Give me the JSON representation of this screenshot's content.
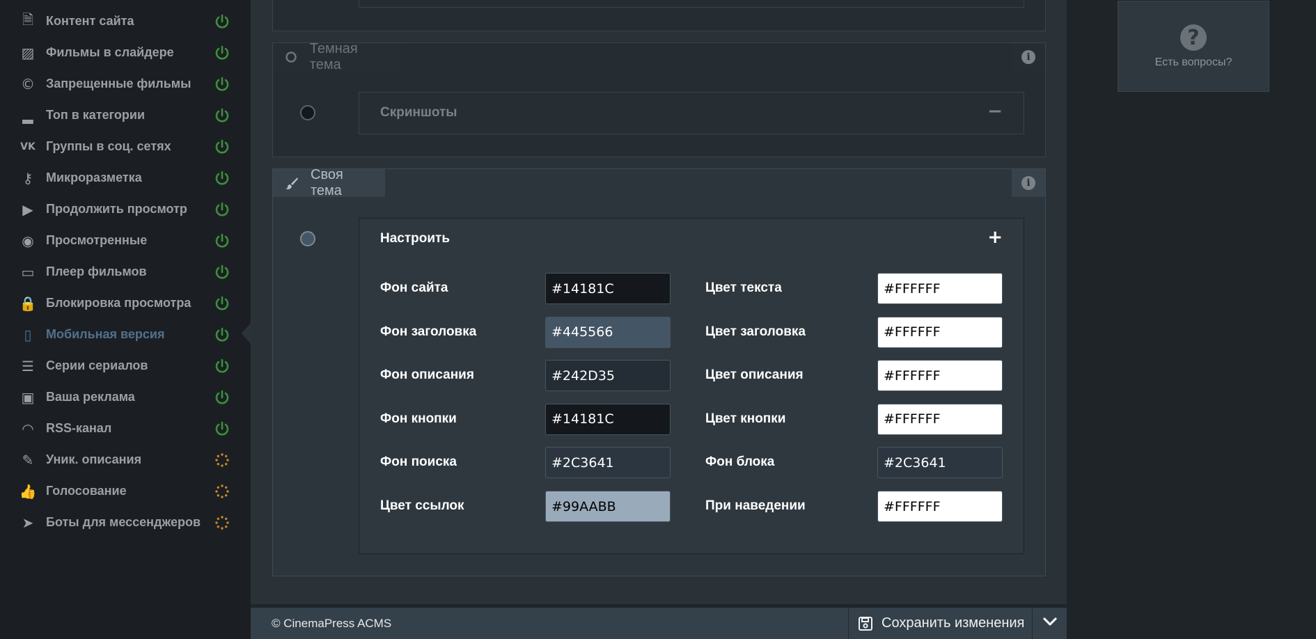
{
  "sidebar": {
    "items": [
      {
        "label": "Контент сайта",
        "icon": "document-icon",
        "status": "power-on"
      },
      {
        "label": "Фильмы в слайдере",
        "icon": "image-icon",
        "status": "power-on"
      },
      {
        "label": "Запрещенные фильмы",
        "icon": "copyright-icon",
        "status": "power-on"
      },
      {
        "label": "Топ в категории",
        "icon": "signal-bars-icon",
        "status": "power-on"
      },
      {
        "label": "Группы в соц. сетях",
        "icon": "vk-icon",
        "status": "power-on"
      },
      {
        "label": "Микроразметка",
        "icon": "key-icon",
        "status": "power-on"
      },
      {
        "label": "Продолжить просмотр",
        "icon": "play-icon",
        "status": "power-on"
      },
      {
        "label": "Просмотренные",
        "icon": "eye-icon",
        "status": "power-on"
      },
      {
        "label": "Плеер фильмов",
        "icon": "monitor-icon",
        "status": "power-on"
      },
      {
        "label": "Блокировка просмотра",
        "icon": "lock-icon",
        "status": "power-on"
      },
      {
        "label": "Мобильная версия",
        "icon": "mobile-icon",
        "status": "power-on",
        "active": true
      },
      {
        "label": "Серии сериалов",
        "icon": "list-icon",
        "status": "power-on"
      },
      {
        "label": "Ваша реклама",
        "icon": "money-icon",
        "status": "power-on"
      },
      {
        "label": "RSS-канал",
        "icon": "rss-icon",
        "status": "power-on"
      },
      {
        "label": "Уник. описания",
        "icon": "pencil-icon",
        "status": "loading"
      },
      {
        "label": "Голосование",
        "icon": "thumbs-up-icon",
        "status": "loading"
      },
      {
        "label": "Боты для мессенджеров",
        "icon": "telegram-icon",
        "status": "loading"
      }
    ]
  },
  "help": {
    "label": "Есть вопросы?",
    "icon": "question-icon"
  },
  "dark_theme": {
    "tab_label": "Темная тема",
    "accordion_title": "Скриншоты",
    "toggle": "−"
  },
  "custom_theme": {
    "tab_label": "Своя тема",
    "accordion_title": "Настроить",
    "toggle": "+",
    "fields": [
      {
        "label": "Фон сайта",
        "value": "#14181C",
        "color": "#14181C",
        "text_color": "#FFFFFF"
      },
      {
        "label": "Фон заголовка",
        "value": "#445566",
        "color": "#445566",
        "text_color": "#FFFFFF"
      },
      {
        "label": "Фон описания",
        "value": "#242D35",
        "color": "#242D35",
        "text_color": "#FFFFFF"
      },
      {
        "label": "Фон кнопки",
        "value": "#14181C",
        "color": "#14181C",
        "text_color": "#FFFFFF"
      },
      {
        "label": "Фон поиска",
        "value": "#2C3641",
        "color": "#2C3641",
        "text_color": "#FFFFFF"
      },
      {
        "label": "Цвет ссылок",
        "value": "#99AABB",
        "color": "#99AABB",
        "text_color": "#000000"
      },
      {
        "label": "Цвет текста",
        "value": "#FFFFFF",
        "color": "#FFFFFF",
        "text_color": "#000000"
      },
      {
        "label": "Цвет заголовка",
        "value": "#FFFFFF",
        "color": "#FFFFFF",
        "text_color": "#000000"
      },
      {
        "label": "Цвет описания",
        "value": "#FFFFFF",
        "color": "#FFFFFF",
        "text_color": "#000000"
      },
      {
        "label": "Цвет кнопки",
        "value": "#FFFFFF",
        "color": "#FFFFFF",
        "text_color": "#000000"
      },
      {
        "label": "Фон блока",
        "value": "#2C3641",
        "color": "#2C3641",
        "text_color": "#FFFFFF"
      },
      {
        "label": "При наведении",
        "value": "#FFFFFF",
        "color": "#FFFFFF",
        "text_color": "#000000"
      }
    ]
  },
  "footer": {
    "copyright": "© CinemaPress ACMS",
    "save_label": "Сохранить изменения"
  },
  "colors": {
    "power_on": "#3c8f3c",
    "loading": "#c8862a",
    "active_nav": "#52718d"
  }
}
